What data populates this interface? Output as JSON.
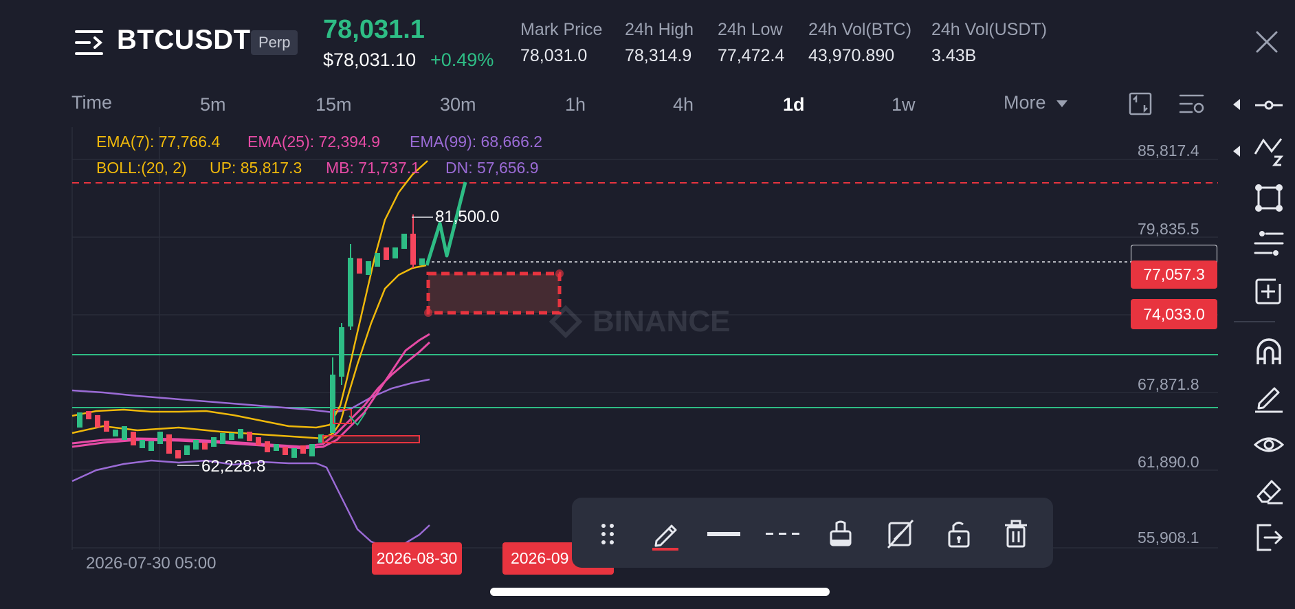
{
  "header": {
    "symbol": "BTCUSDT",
    "contract_type": "Perp",
    "last_price": "78,031.1",
    "usd_price": "$78,031.10",
    "change_pct": "+0.49%",
    "stats": [
      {
        "label": "Mark Price",
        "value": "78,031.0"
      },
      {
        "label": "24h High",
        "value": "78,314.9"
      },
      {
        "label": "24h Low",
        "value": "77,472.4"
      },
      {
        "label": "24h Vol(BTC)",
        "value": "43,970.890"
      },
      {
        "label": "24h Vol(USDT)",
        "value": "3.43B"
      }
    ]
  },
  "timeframes": {
    "items": [
      "Time",
      "5m",
      "15m",
      "30m",
      "1h",
      "4h",
      "1d",
      "1w"
    ],
    "active": "1d",
    "more_label": "More"
  },
  "indicators": {
    "ema7": "EMA(7): 77,766.4",
    "ema25": "EMA(25): 72,394.9",
    "ema99": "EMA(99): 68,666.2",
    "boll": "BOLL:(20, 2)",
    "boll_up": "UP: 85,817.3",
    "boll_mb": "MB: 71,737.1",
    "boll_dn": "DN: 57,656.9"
  },
  "chart": {
    "y_labels": [
      "85,817.4",
      "79,835.5",
      "67,871.8",
      "61,890.0",
      "55,908.1"
    ],
    "price_tags": [
      "77,057.3",
      "74,033.0"
    ],
    "high_marker": "81,500.0",
    "low_marker": "62,228.8",
    "x_start_label": "2026-07-30 05:00",
    "date_tags": [
      "2026-08-30",
      "2026-09"
    ],
    "watermark": "BINANCE"
  },
  "colors": {
    "up": "#2ebd85",
    "down": "#f6465d",
    "ema7": "#f0b90b",
    "ema25": "#e64ba5",
    "ema99": "#9b6bd6",
    "alert": "#e8343f",
    "background": "#1c1e2b"
  },
  "drawing_toolbar": {
    "tools": [
      "drag-handle-icon",
      "pencil-icon",
      "solid-line-icon",
      "dashed-line-icon",
      "paint-bucket-icon",
      "hide-drawing-icon",
      "unlock-icon",
      "trash-icon"
    ]
  },
  "right_toolbar": {
    "tools": [
      "horizontal-line-tool-icon",
      "trend-line-tool-icon",
      "rectangle-tool-icon",
      "fib-tool-icon",
      "measure-tool-icon",
      "magnet-icon",
      "pencil-tool-icon",
      "eye-icon",
      "eraser-icon",
      "exit-icon"
    ]
  },
  "chart_data": {
    "type": "candlestick",
    "title": "BTCUSDT Perp 1d",
    "y_axis_ticks": [
      85817.4,
      79835.5,
      67871.8,
      61890.0,
      55908.1
    ],
    "ylim": [
      55000,
      88000
    ],
    "last_price": 78031.1,
    "high_marker": 81500.0,
    "low_marker": 62228.8,
    "x_start": "2026-07-30 05:00",
    "indicators": {
      "EMA7": 77766.4,
      "EMA25": 72394.9,
      "EMA99": 68666.2,
      "BOLL_UP": 85817.3,
      "BOLL_MB": 71737.1,
      "BOLL_DN": 57656.9
    },
    "price_levels": [
      77057.3,
      74033.0
    ],
    "grid": true
  }
}
